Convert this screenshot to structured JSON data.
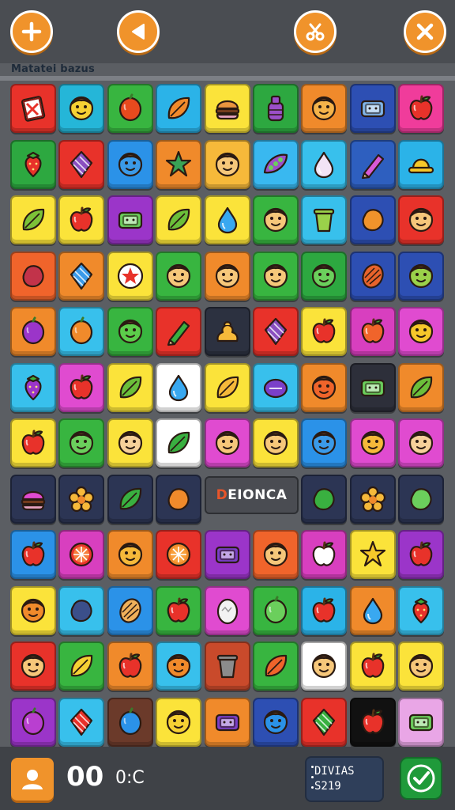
{
  "header": {
    "subtitle": "Matatei bazus",
    "buttons": [
      {
        "name": "add-button",
        "icon": "plus-icon"
      },
      {
        "name": "back-button",
        "icon": "play-left-icon"
      },
      {
        "name": "tools-button",
        "icon": "scissors-icon"
      },
      {
        "name": "close-button",
        "icon": "close-icon"
      }
    ]
  },
  "board": {
    "banner_text": "DEIONCA",
    "rows": [
      [
        {
          "bg": "#e8322a",
          "icon": "card"
        },
        {
          "bg": "#25b6d8",
          "icon": "face",
          "c": "#f6d134"
        },
        {
          "bg": "#38b540",
          "icon": "fruit",
          "c": "#e84a1e"
        },
        {
          "bg": "#2bb3e8",
          "icon": "leaf",
          "c": "#f08a2b"
        },
        {
          "bg": "#fbe33a",
          "icon": "burger",
          "c": "#e9953f"
        },
        {
          "bg": "#2da840",
          "icon": "bottle",
          "c": "#9b4fc9"
        },
        {
          "bg": "#f08a2b",
          "icon": "face",
          "c": "#f5b34a"
        },
        {
          "bg": "#2d4fb3",
          "icon": "box",
          "c": "#7fb4e8"
        },
        {
          "bg": "#f03c9b",
          "icon": "apple",
          "c": "#e8322a"
        }
      ],
      [
        {
          "bg": "#2da840",
          "icon": "berry",
          "c": "#e8322a"
        },
        {
          "bg": "#e8322a",
          "icon": "gem",
          "c": "#8a4fbf"
        },
        {
          "bg": "#2b92e8",
          "icon": "face",
          "c": "#3b9ae8"
        },
        {
          "bg": "#f08a2b",
          "icon": "star",
          "c": "#39a356"
        },
        {
          "bg": "#f6b93a",
          "icon": "face",
          "c": "#f6c77a"
        },
        {
          "bg": "#39b8f0",
          "icon": "pod",
          "c": "#9b4fc9"
        },
        {
          "bg": "#38c0ec",
          "icon": "drop",
          "c": "#f2e3f5"
        },
        {
          "bg": "#2e5fbf",
          "icon": "pencil",
          "c": "#d75ad6"
        },
        {
          "bg": "#2bb3e8",
          "icon": "hat",
          "c": "#f6c72a"
        }
      ],
      [
        {
          "bg": "#fbe33a",
          "icon": "leaf",
          "c": "#7cc238"
        },
        {
          "bg": "#fbe33a",
          "icon": "apple",
          "c": "#e8322a"
        },
        {
          "bg": "#9b35c9",
          "icon": "box",
          "c": "#6bcf5c"
        },
        {
          "bg": "#fbe33a",
          "icon": "leaf",
          "c": "#6bbf3a"
        },
        {
          "bg": "#fbe33a",
          "icon": "drop",
          "c": "#39a8f0"
        },
        {
          "bg": "#38b540",
          "icon": "face",
          "c": "#f6c77a"
        },
        {
          "bg": "#38c0ec",
          "icon": "cup",
          "c": "#9ad14a"
        },
        {
          "bg": "#2d4fb3",
          "icon": "blob",
          "c": "#f0932b"
        },
        {
          "bg": "#e8322a",
          "icon": "face",
          "c": "#f6c77a"
        }
      ],
      [
        {
          "bg": "#f0642b",
          "icon": "blob",
          "c": "#c2334a"
        },
        {
          "bg": "#f08a2b",
          "icon": "gem",
          "c": "#3b9ae8"
        },
        {
          "bg": "#fbe33a",
          "icon": "badge",
          "c": "#e8322a"
        },
        {
          "bg": "#38b540",
          "icon": "face",
          "c": "#f6c77a"
        },
        {
          "bg": "#f08a2b",
          "icon": "face",
          "c": "#f6c77a"
        },
        {
          "bg": "#38b540",
          "icon": "face",
          "c": "#f6c77a"
        },
        {
          "bg": "#2da840",
          "icon": "face",
          "c": "#6bcf5c"
        },
        {
          "bg": "#2d4fb3",
          "icon": "nut",
          "c": "#e8632b"
        },
        {
          "bg": "#2d4fb3",
          "icon": "face",
          "c": "#9ad14a"
        }
      ],
      [
        {
          "bg": "#f08a2b",
          "icon": "fruit",
          "c": "#9b35c9"
        },
        {
          "bg": "#38c0ec",
          "icon": "fruit",
          "c": "#f08a2b"
        },
        {
          "bg": "#38b540",
          "icon": "face",
          "c": "#5ccd4a"
        },
        {
          "bg": "#e8322a",
          "icon": "pencil",
          "c": "#39b040"
        },
        {
          "bg": "#2c3140",
          "icon": "pile",
          "c": "#f6b93a"
        },
        {
          "bg": "#e8322a",
          "icon": "gem",
          "c": "#8a4fbf"
        },
        {
          "bg": "#fbe33a",
          "icon": "apple",
          "c": "#e8322a"
        },
        {
          "bg": "#d83fbf",
          "icon": "apple",
          "c": "#f0642b"
        },
        {
          "bg": "#e04bd0",
          "icon": "face",
          "c": "#f6c72a"
        }
      ],
      [
        {
          "bg": "#38c0ec",
          "icon": "berry",
          "c": "#9b35c9"
        },
        {
          "bg": "#e04bd0",
          "icon": "apple",
          "c": "#e8322a"
        },
        {
          "bg": "#fbe33a",
          "icon": "leaf",
          "c": "#6bbf3a"
        },
        {
          "bg": "#ffffff",
          "icon": "drop",
          "c": "#39a8f0"
        },
        {
          "bg": "#fbe33a",
          "icon": "leaf",
          "c": "#f6b93a"
        },
        {
          "bg": "#38c0ec",
          "icon": "disc",
          "c": "#7b3fc9"
        },
        {
          "bg": "#f08a2b",
          "icon": "face",
          "c": "#f0642b"
        },
        {
          "bg": "#2d2f3a",
          "icon": "box",
          "c": "#6bcf5c"
        },
        {
          "bg": "#f08a2b",
          "icon": "leaf",
          "c": "#6bbf3a"
        }
      ],
      [
        {
          "bg": "#fbe33a",
          "icon": "apple",
          "c": "#e8322a"
        },
        {
          "bg": "#38b540",
          "icon": "face",
          "c": "#6bcf5c"
        },
        {
          "bg": "#fbe33a",
          "icon": "face",
          "c": "#f6d09a"
        },
        {
          "bg": "#ffffff",
          "icon": "leaf",
          "c": "#39b040"
        },
        {
          "bg": "#e04bd0",
          "icon": "face",
          "c": "#f6c77a"
        },
        {
          "bg": "#fbe33a",
          "icon": "face",
          "c": "#f6c77a"
        },
        {
          "bg": "#2b92e8",
          "icon": "face",
          "c": "#3b9ae8"
        },
        {
          "bg": "#e04bd0",
          "icon": "face",
          "c": "#f6b93a"
        },
        {
          "bg": "#e04bd0",
          "icon": "face",
          "c": "#f6d09a"
        }
      ],
      [
        {
          "bg": "#2c3554",
          "icon": "burger",
          "c": "#e04bd0"
        },
        {
          "bg": "#2c3554",
          "icon": "flower",
          "c": "#f6b93a"
        },
        {
          "bg": "#2c3554",
          "icon": "leaf",
          "c": "#39b040"
        },
        {
          "bg": "#2c3554",
          "icon": "blob",
          "c": "#f08a2b"
        },
        null,
        null,
        {
          "bg": "#2c3554",
          "icon": "blob",
          "c": "#39b040"
        },
        {
          "bg": "#2c3554",
          "icon": "flower",
          "c": "#f6b93a"
        },
        {
          "bg": "#2c3554",
          "icon": "blob",
          "c": "#6bcf5c"
        }
      ],
      [
        {
          "bg": "#2b92e8",
          "icon": "apple",
          "c": "#e8322a"
        },
        {
          "bg": "#d83fbf",
          "icon": "citrus",
          "c": "#e8322a"
        },
        {
          "bg": "#f08a2b",
          "icon": "face",
          "c": "#f6b93a"
        },
        {
          "bg": "#e8322a",
          "icon": "citrus",
          "c": "#f08a2b"
        },
        {
          "bg": "#9b35c9",
          "icon": "box",
          "c": "#7b3fc9"
        },
        {
          "bg": "#f0642b",
          "icon": "face",
          "c": "#f6c77a"
        },
        {
          "bg": "#d83fbf",
          "icon": "apple",
          "c": "#ffffff"
        },
        {
          "bg": "#fbe33a",
          "icon": "star",
          "c": "#f6c72a"
        },
        {
          "bg": "#9b35c9",
          "icon": "apple",
          "c": "#e8322a"
        }
      ],
      [
        {
          "bg": "#fbe33a",
          "icon": "face",
          "c": "#f08a2b"
        },
        {
          "bg": "#38c0ec",
          "icon": "blob",
          "c": "#3b4f8a"
        },
        {
          "bg": "#2b92e8",
          "icon": "nut",
          "c": "#f0b05a"
        },
        {
          "bg": "#38b540",
          "icon": "apple",
          "c": "#e8322a"
        },
        {
          "bg": "#e04bd0",
          "icon": "egg",
          "c": "#f2f2f2"
        },
        {
          "bg": "#38b540",
          "icon": "fruit",
          "c": "#6bcf5c"
        },
        {
          "bg": "#2bb3e8",
          "icon": "apple",
          "c": "#e8322a"
        },
        {
          "bg": "#f08a2b",
          "icon": "drop",
          "c": "#39a8f0"
        },
        {
          "bg": "#38c0ec",
          "icon": "berry",
          "c": "#e8322a"
        }
      ],
      [
        {
          "bg": "#e8322a",
          "icon": "face",
          "c": "#f6c77a"
        },
        {
          "bg": "#38b540",
          "icon": "leaf",
          "c": "#f6d134"
        },
        {
          "bg": "#f08a2b",
          "icon": "apple",
          "c": "#e8322a"
        },
        {
          "bg": "#38c0ec",
          "icon": "face",
          "c": "#f08a2b"
        },
        {
          "bg": "#c94a2b",
          "icon": "cup",
          "c": "#8c8c8c"
        },
        {
          "bg": "#38b540",
          "icon": "leaf",
          "c": "#f0642b"
        },
        {
          "bg": "#ffffff",
          "icon": "face",
          "c": "#f6c77a"
        },
        {
          "bg": "#fbe33a",
          "icon": "apple",
          "c": "#e8322a"
        },
        {
          "bg": "#fbe33a",
          "icon": "face",
          "c": "#f6c77a"
        }
      ],
      [
        {
          "bg": "#9b35c9",
          "icon": "fruit",
          "c": "#b93fd0"
        },
        {
          "bg": "#38c0ec",
          "icon": "gem",
          "c": "#e8322a"
        },
        {
          "bg": "#6b3a2a",
          "icon": "fruit",
          "c": "#2b92e8"
        },
        {
          "bg": "#fbe33a",
          "icon": "face",
          "c": "#f6d134"
        },
        {
          "bg": "#f08a2b",
          "icon": "box",
          "c": "#7b3fc9"
        },
        {
          "bg": "#2d4fb3",
          "icon": "face",
          "c": "#2b92e8"
        },
        {
          "bg": "#e8322a",
          "icon": "gem",
          "c": "#39b040"
        },
        {
          "bg": "#111111",
          "icon": "apple",
          "c": "#e8322a"
        },
        {
          "bg": "#e9a6e6",
          "icon": "box",
          "c": "#6bcf5c"
        }
      ]
    ]
  },
  "footer": {
    "score": "00",
    "timer": "0:C",
    "stats_line1": "DIVIAS",
    "stats_line2": "S219",
    "avatar_icon": "user-icon",
    "confirm_icon": "check-icon"
  }
}
